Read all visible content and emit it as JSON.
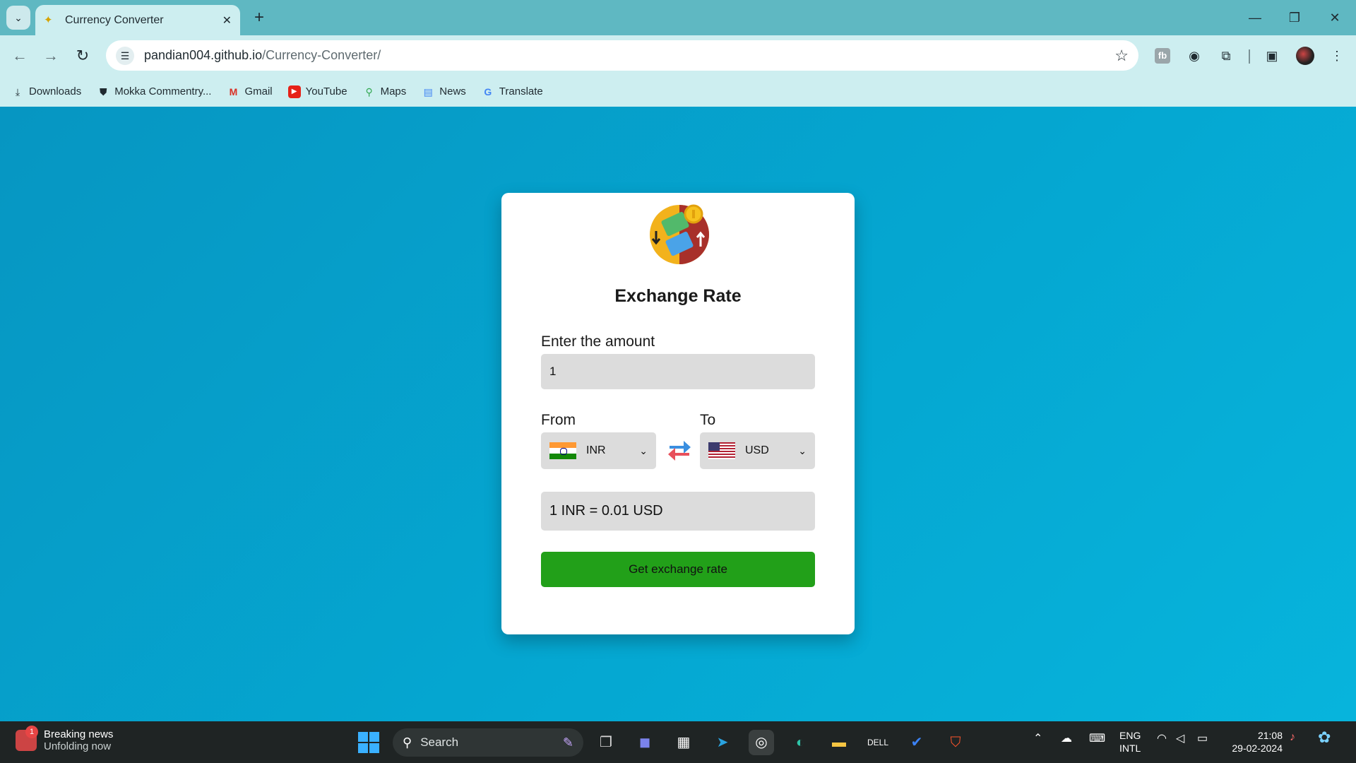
{
  "browser": {
    "tab_title": "Currency Converter",
    "url_host": "pandian004.github.io",
    "url_path": "/Currency-Converter/",
    "bookmarks": [
      {
        "label": "Downloads",
        "icon": "download-icon"
      },
      {
        "label": "Mokka Commentry...",
        "icon": "shield-icon"
      },
      {
        "label": "Gmail",
        "icon": "gmail-icon"
      },
      {
        "label": "YouTube",
        "icon": "youtube-icon"
      },
      {
        "label": "Maps",
        "icon": "maps-icon"
      },
      {
        "label": "News",
        "icon": "news-icon"
      },
      {
        "label": "Translate",
        "icon": "translate-icon"
      }
    ]
  },
  "app": {
    "title": "Exchange Rate",
    "amount_label": "Enter the amount",
    "amount_value": "1",
    "from_label": "From",
    "to_label": "To",
    "from_currency": "INR",
    "to_currency": "USD",
    "result": "1 INR = 0.01 USD",
    "button_label": "Get exchange rate",
    "colors": {
      "button": "#22a019",
      "page_bg": "#0aa0c8"
    }
  },
  "taskbar": {
    "news_title": "Breaking news",
    "news_sub": "Unfolding now",
    "news_badge": "1",
    "search_placeholder": "Search",
    "lang_1": "ENG",
    "lang_2": "INTL",
    "time": "21:08",
    "date": "29-02-2024"
  }
}
